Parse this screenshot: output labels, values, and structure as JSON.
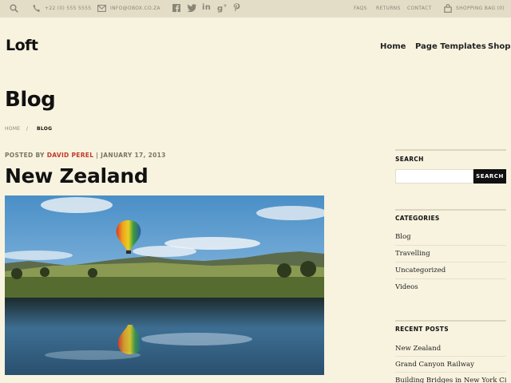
{
  "topbar": {
    "phone": "+22 (0) 555 5555",
    "email": "INFO@OBOX.CO.ZA",
    "links": [
      "FAQS",
      "RETURNS",
      "CONTACT"
    ],
    "cart": "SHOPPING BAG (0)"
  },
  "header": {
    "logo": "Loft",
    "nav": [
      "Home",
      "Page Templates",
      "Shop"
    ]
  },
  "page": {
    "title": "Blog",
    "breadcrumb": {
      "home": "HOME",
      "separator": "/",
      "current": "BLOG"
    }
  },
  "post": {
    "meta_prefix": "POSTED BY",
    "author": "DAVID PEREL",
    "meta_sep": "|",
    "date": "JANUARY 17, 2013",
    "title": "New Zealand"
  },
  "sidebar": {
    "search": {
      "heading": "SEARCH",
      "placeholder": "",
      "button": "SEARCH"
    },
    "categories": {
      "heading": "CATEGORIES",
      "items": [
        "Blog",
        "Travelling",
        "Uncategorized",
        "Videos"
      ]
    },
    "recent": {
      "heading": "RECENT POSTS",
      "items": [
        "New Zealand",
        "Grand Canyon Railway",
        "Building Bridges in New York City"
      ]
    }
  },
  "colors": {
    "background": "#f8f3df",
    "topbar": "#e3ddc8",
    "accent": "#c0392b",
    "button": "#111111"
  }
}
